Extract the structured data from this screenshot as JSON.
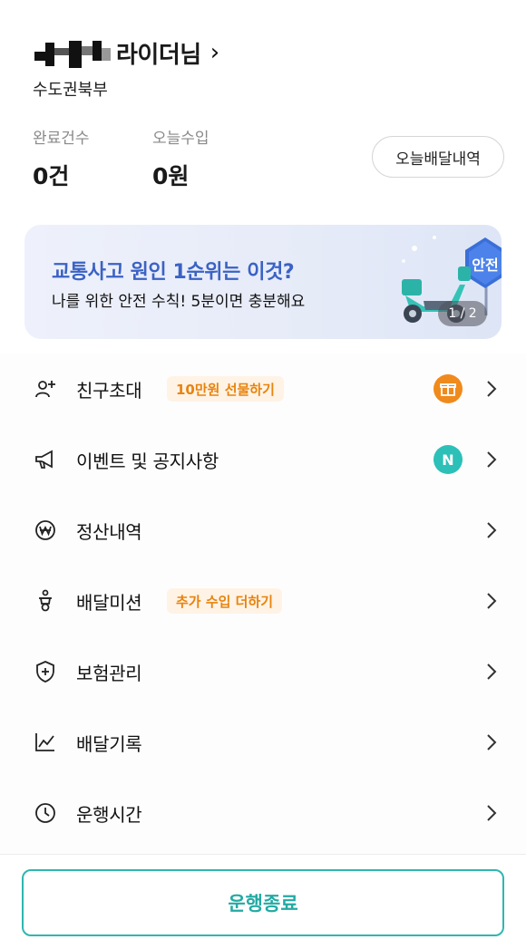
{
  "rider": {
    "title": "라이더님",
    "chevron": "›",
    "region": "수도권북부"
  },
  "stats": [
    {
      "label": "완료건수",
      "value": "0건"
    },
    {
      "label": "오늘수입",
      "value": "0원"
    }
  ],
  "today_history_label": "오늘배달내역",
  "banner": {
    "title": "교통사고 원인 1순위는 이것?",
    "subtitle": "나를 위한 안전 수칙! 5분이면 충분해요",
    "sign_text": "안전",
    "pager": "1 / 2"
  },
  "menu": {
    "invite": {
      "label": "친구초대",
      "badge": "10만원 선물하기",
      "icon": "person-add-icon"
    },
    "events": {
      "label": "이벤트 및 공지사항",
      "dot": "N",
      "icon": "megaphone-icon"
    },
    "settlement": {
      "label": "정산내역",
      "icon": "won-coin-icon"
    },
    "mission": {
      "label": "배달미션",
      "badge": "추가 수입 더하기",
      "icon": "scooter-rider-icon"
    },
    "insurance": {
      "label": "보험관리",
      "icon": "shield-plus-icon"
    },
    "records": {
      "label": "배달기록",
      "icon": "line-chart-icon"
    },
    "hours": {
      "label": "운행시간",
      "icon": "clock-icon"
    }
  },
  "end_button_label": "운행종료",
  "colors": {
    "accent_teal": "#2fb7b0",
    "badge_orange": "#e8840e",
    "banner_blue": "#3b62c4",
    "gift_orange": "#f08a1c",
    "n_teal": "#2cc0b8"
  }
}
